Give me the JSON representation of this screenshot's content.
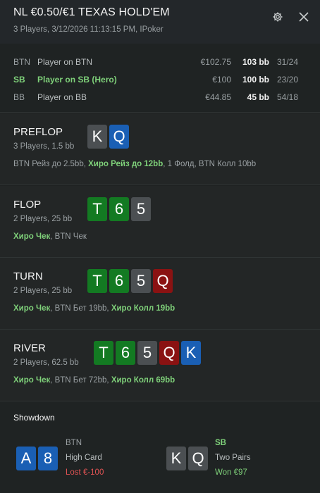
{
  "header": {
    "title": "NL €0.50/€1 TEXAS HOLD'EM",
    "subtitle": "3 Players, 3/12/2026 11:13:15 PM, IPoker"
  },
  "players": [
    {
      "position": "BTN",
      "name": "Player on BTN",
      "stack": "€102.75",
      "bb": "103 bb",
      "stat": "31/24",
      "hero": false
    },
    {
      "position": "SB",
      "name": "Player on SB (Hero)",
      "stack": "€100",
      "bb": "100 bb",
      "stat": "23/20",
      "hero": true
    },
    {
      "position": "BB",
      "name": "Player on BB",
      "stack": "€44.85",
      "bb": "45 bb",
      "stat": "54/18",
      "hero": false
    }
  ],
  "streets": {
    "preflop": {
      "name": "PREFLOP",
      "info": "3 Players, 1.5 bb",
      "cards": [
        {
          "rank": "K",
          "color": "gray"
        },
        {
          "rank": "Q",
          "color": "blue"
        }
      ],
      "actions": [
        "BTN Рейз до 2.5bb, ",
        "Хиро Рейз до 12bb",
        ", 1 Фолд, BTN Колл 10bb"
      ]
    },
    "flop": {
      "name": "FLOP",
      "info": "2 Players, 25 bb",
      "cards": [
        {
          "rank": "T",
          "color": "green"
        },
        {
          "rank": "6",
          "color": "green"
        },
        {
          "rank": "5",
          "color": "gray"
        }
      ],
      "actions": [
        "Хиро Чек",
        ", BTN Чек"
      ]
    },
    "turn": {
      "name": "TURN",
      "info": "2 Players, 25 bb",
      "cards": [
        {
          "rank": "T",
          "color": "green"
        },
        {
          "rank": "6",
          "color": "green"
        },
        {
          "rank": "5",
          "color": "gray"
        },
        {
          "rank": "Q",
          "color": "red"
        }
      ],
      "actions": [
        "Хиро Чек",
        ", BTN Бет 19bb, ",
        "Хиро Колл 19bb"
      ]
    },
    "river": {
      "name": "RIVER",
      "info": "2 Players, 62.5 bb",
      "cards": [
        {
          "rank": "T",
          "color": "green"
        },
        {
          "rank": "6",
          "color": "green"
        },
        {
          "rank": "5",
          "color": "gray"
        },
        {
          "rank": "Q",
          "color": "red"
        },
        {
          "rank": "K",
          "color": "blue"
        }
      ],
      "actions": [
        "Хиро Чек",
        ", BTN Бет 72bb, ",
        "Хиро Колл 69bb"
      ]
    }
  },
  "showdown": {
    "title": "Showdown",
    "players": [
      {
        "position": "BTN",
        "hand": "High Card",
        "result": "Lost €-100",
        "cards": [
          {
            "rank": "A",
            "color": "blue"
          },
          {
            "rank": "8",
            "color": "blue"
          }
        ]
      },
      {
        "position": "SB",
        "hand": "Two Pairs",
        "result": "Won €97",
        "cards": [
          {
            "rank": "K",
            "color": "gray"
          },
          {
            "rank": "Q",
            "color": "gray"
          }
        ]
      }
    ]
  },
  "colors": {
    "card_gray": "#4b4f52",
    "card_blue": "#1a5fb4",
    "card_green": "#137a22",
    "card_red": "#8a1212",
    "hero": "#7fd17a",
    "lost": "#e05353"
  },
  "icons": {
    "settings": "gear-icon",
    "close": "close-icon"
  }
}
